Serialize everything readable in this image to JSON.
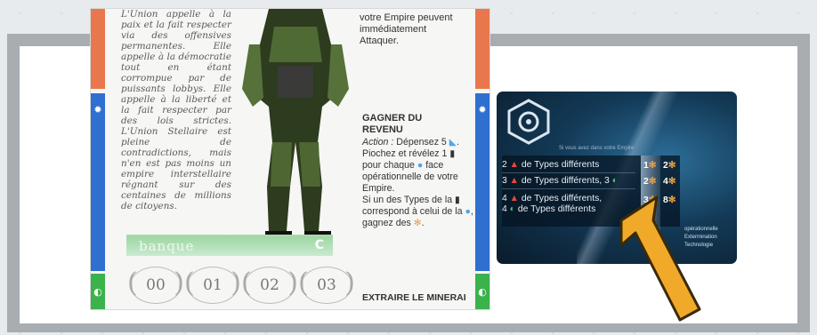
{
  "left_card": {
    "flavor_text": "L'Union appelle à la paix et la fait respecter via des offensives permanentes. Elle appelle à la démocratie tout en étant corrompue par de puissants lobbys. Elle appelle à la liberté et la fait respecter par des lois strictes. L'Union Stellaire est pleine de contradictions, mais n'en est pas moins un empire interstellaire régnant sur des centaines de millions de citoyens.",
    "top_right_text": "votre Empire peuvent immédiatement Attaquer.",
    "gagner_title": "GAGNER DU REVENU",
    "gagner_action_label": "Action :",
    "gagner_body_1": " Dépensez 5 ",
    "gagner_body_2": ". Piochez et révélez 1 ",
    "gagner_body_3": " pour chaque ",
    "gagner_body_4": " face opérationnelle de votre Empire.",
    "gagner_body_5": "Si un des Types de la ",
    "gagner_body_6": " correspond à celui de la ",
    "gagner_body_7": ", gagnez des ",
    "gagner_body_8": ".",
    "extraire_title": "EXTRAIRE LE MINERAI",
    "banque_label": "banque",
    "banque_icon": "C",
    "slots": [
      "00",
      "01",
      "02",
      "03"
    ]
  },
  "right_card": {
    "subtitle": "Si vous avez dans votre Empire",
    "rows": [
      {
        "text": "de Types différents",
        "count_a": "2",
        "val_a": "1",
        "val_b": "2"
      },
      {
        "text": "de Types différents, 3",
        "count_a": "3",
        "val_a": "2",
        "val_b": "4"
      },
      {
        "text_1": "de Types différents,",
        "text_2": "de Types différents",
        "count_a": "4",
        "count_b": "4",
        "val_a": "3",
        "val_b": "8"
      }
    ],
    "types": [
      "opérationnelle",
      "Extermination",
      "Technologie"
    ]
  },
  "colors": {
    "red": "#e9774e",
    "blue": "#2f6fd0",
    "green": "#3bb24b",
    "arrow": "#f0a929"
  },
  "icons": [
    "gear-icon",
    "coin-icon",
    "resource-icon",
    "arrow-icon"
  ]
}
